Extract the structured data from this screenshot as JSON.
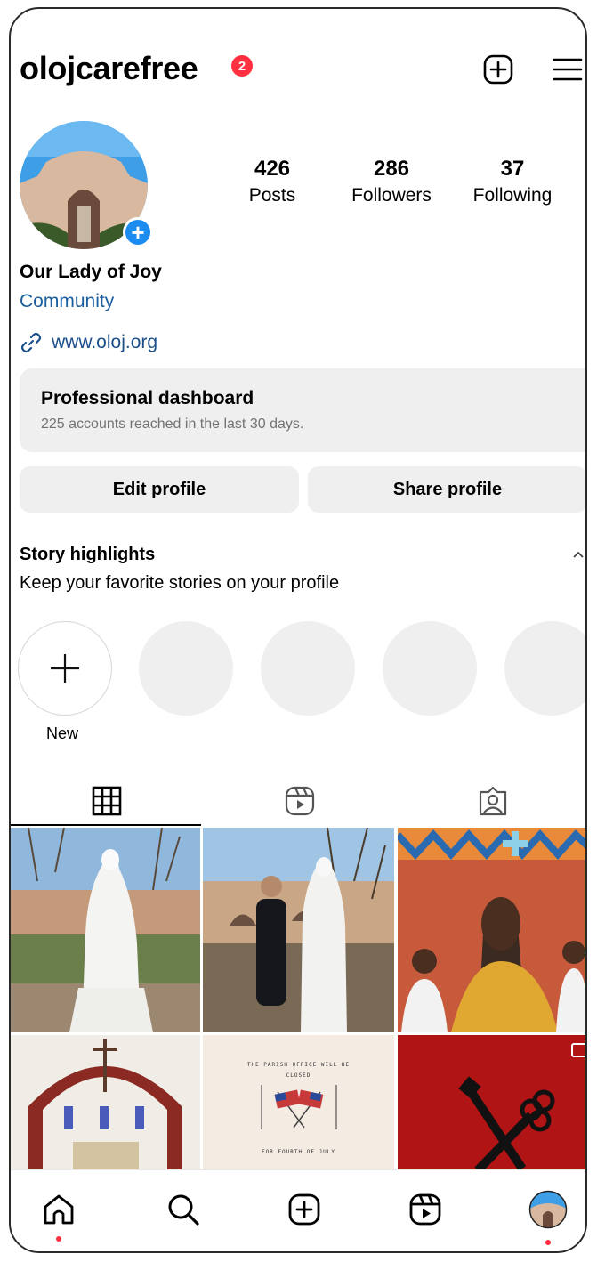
{
  "header": {
    "username": "olojcarefree",
    "notification_count": "2"
  },
  "profile": {
    "stats": [
      {
        "value": "426",
        "label": "Posts"
      },
      {
        "value": "286",
        "label": "Followers"
      },
      {
        "value": "37",
        "label": "Following"
      }
    ],
    "name": "Our Lady of Joy",
    "category": "Community",
    "website": "www.oloj.org"
  },
  "dashboard": {
    "title": "Professional dashboard",
    "subtitle": "225 accounts reached in the last 30 days."
  },
  "buttons": {
    "edit": "Edit profile",
    "share": "Share profile"
  },
  "highlights": {
    "title": "Story highlights",
    "subtitle": "Keep your favorite stories on your profile",
    "new_label": "New"
  },
  "tabs": [
    "grid-icon",
    "reels-icon",
    "tagged-icon"
  ],
  "posts": [
    {
      "alt": "Statue of Mary in garden"
    },
    {
      "alt": "Priest beside statue of Mary"
    },
    {
      "alt": "Mural painting"
    },
    {
      "alt": "Church altar with crucifix"
    },
    {
      "lines": [
        "THE PARISH OFFICE WILL BE",
        "CLOSED",
        "FOR FOURTH OF JULY"
      ]
    },
    {
      "alt": "Crossed keys on red"
    }
  ],
  "bottom_nav": [
    "home-icon",
    "search-icon",
    "create-icon",
    "reels-icon",
    "profile-avatar"
  ],
  "colors": {
    "accent_blue": "#1d8cf0",
    "badge_red": "#ff3040",
    "card_bg": "#efefef",
    "link_blue": "#1a5fa0"
  }
}
